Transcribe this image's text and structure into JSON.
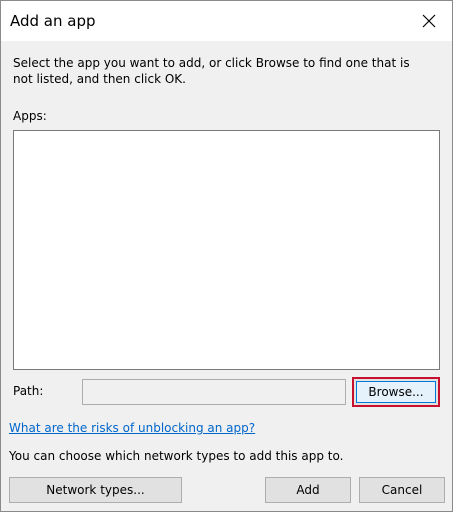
{
  "window": {
    "title": "Add an app"
  },
  "dialog": {
    "intro_text": "Select the app you want to add, or click Browse to find one that is not listed, and then click OK.",
    "apps_label": "Apps:",
    "path_label": "Path:",
    "path_value": "",
    "browse_label": "Browse...",
    "risk_link": "What are the risks of unblocking an app?",
    "network_text": "You can choose which network types to add this app to.",
    "network_types_label": "Network types...",
    "add_label": "Add",
    "cancel_label": "Cancel"
  },
  "icons": {
    "close": "close-icon"
  },
  "colors": {
    "link": "#0066cc",
    "browse_highlight": "#c8102e",
    "focus_border": "#0078d7"
  }
}
